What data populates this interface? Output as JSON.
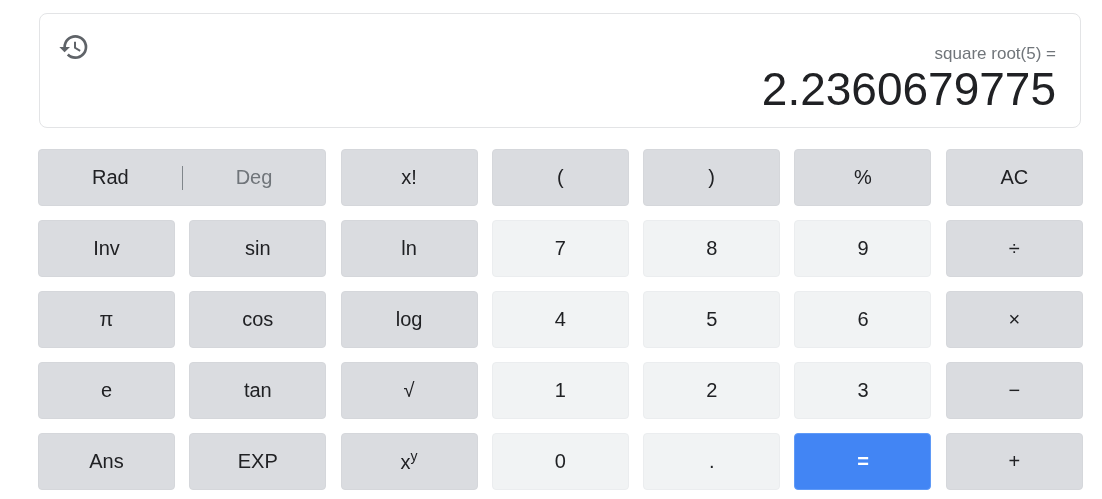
{
  "display": {
    "expression": "square root(5) =",
    "result": "2.2360679775"
  },
  "angle_mode": [
    {
      "label": "Rad",
      "selected": true
    },
    {
      "label": "Deg",
      "selected": false
    }
  ],
  "keys": [
    {
      "label": "x!",
      "kind": "function"
    },
    {
      "label": "(",
      "kind": "function"
    },
    {
      "label": ")",
      "kind": "function"
    },
    {
      "label": "%",
      "kind": "function"
    },
    {
      "label": "AC",
      "kind": "function"
    },
    {
      "label": "Inv",
      "kind": "function"
    },
    {
      "label": "sin",
      "kind": "function"
    },
    {
      "label": "ln",
      "kind": "function"
    },
    {
      "label": "7",
      "kind": "digit"
    },
    {
      "label": "8",
      "kind": "digit"
    },
    {
      "label": "9",
      "kind": "digit"
    },
    {
      "label": "÷",
      "kind": "function"
    },
    {
      "label": "π",
      "kind": "function"
    },
    {
      "label": "cos",
      "kind": "function"
    },
    {
      "label": "log",
      "kind": "function"
    },
    {
      "label": "4",
      "kind": "digit"
    },
    {
      "label": "5",
      "kind": "digit"
    },
    {
      "label": "6",
      "kind": "digit"
    },
    {
      "label": "×",
      "kind": "function"
    },
    {
      "label": "e",
      "kind": "function"
    },
    {
      "label": "tan",
      "kind": "function"
    },
    {
      "label": "√",
      "kind": "function"
    },
    {
      "label": "1",
      "kind": "digit"
    },
    {
      "label": "2",
      "kind": "digit"
    },
    {
      "label": "3",
      "kind": "digit"
    },
    {
      "label": "−",
      "kind": "function"
    },
    {
      "label": "Ans",
      "kind": "function"
    },
    {
      "label": "EXP",
      "kind": "function"
    },
    {
      "label": "x$^{y}$",
      "kind": "function"
    },
    {
      "label": "0",
      "kind": "digit"
    },
    {
      "label": ".",
      "kind": "digit"
    },
    {
      "label": "=",
      "kind": "equals"
    },
    {
      "label": "+",
      "kind": "function"
    }
  ]
}
